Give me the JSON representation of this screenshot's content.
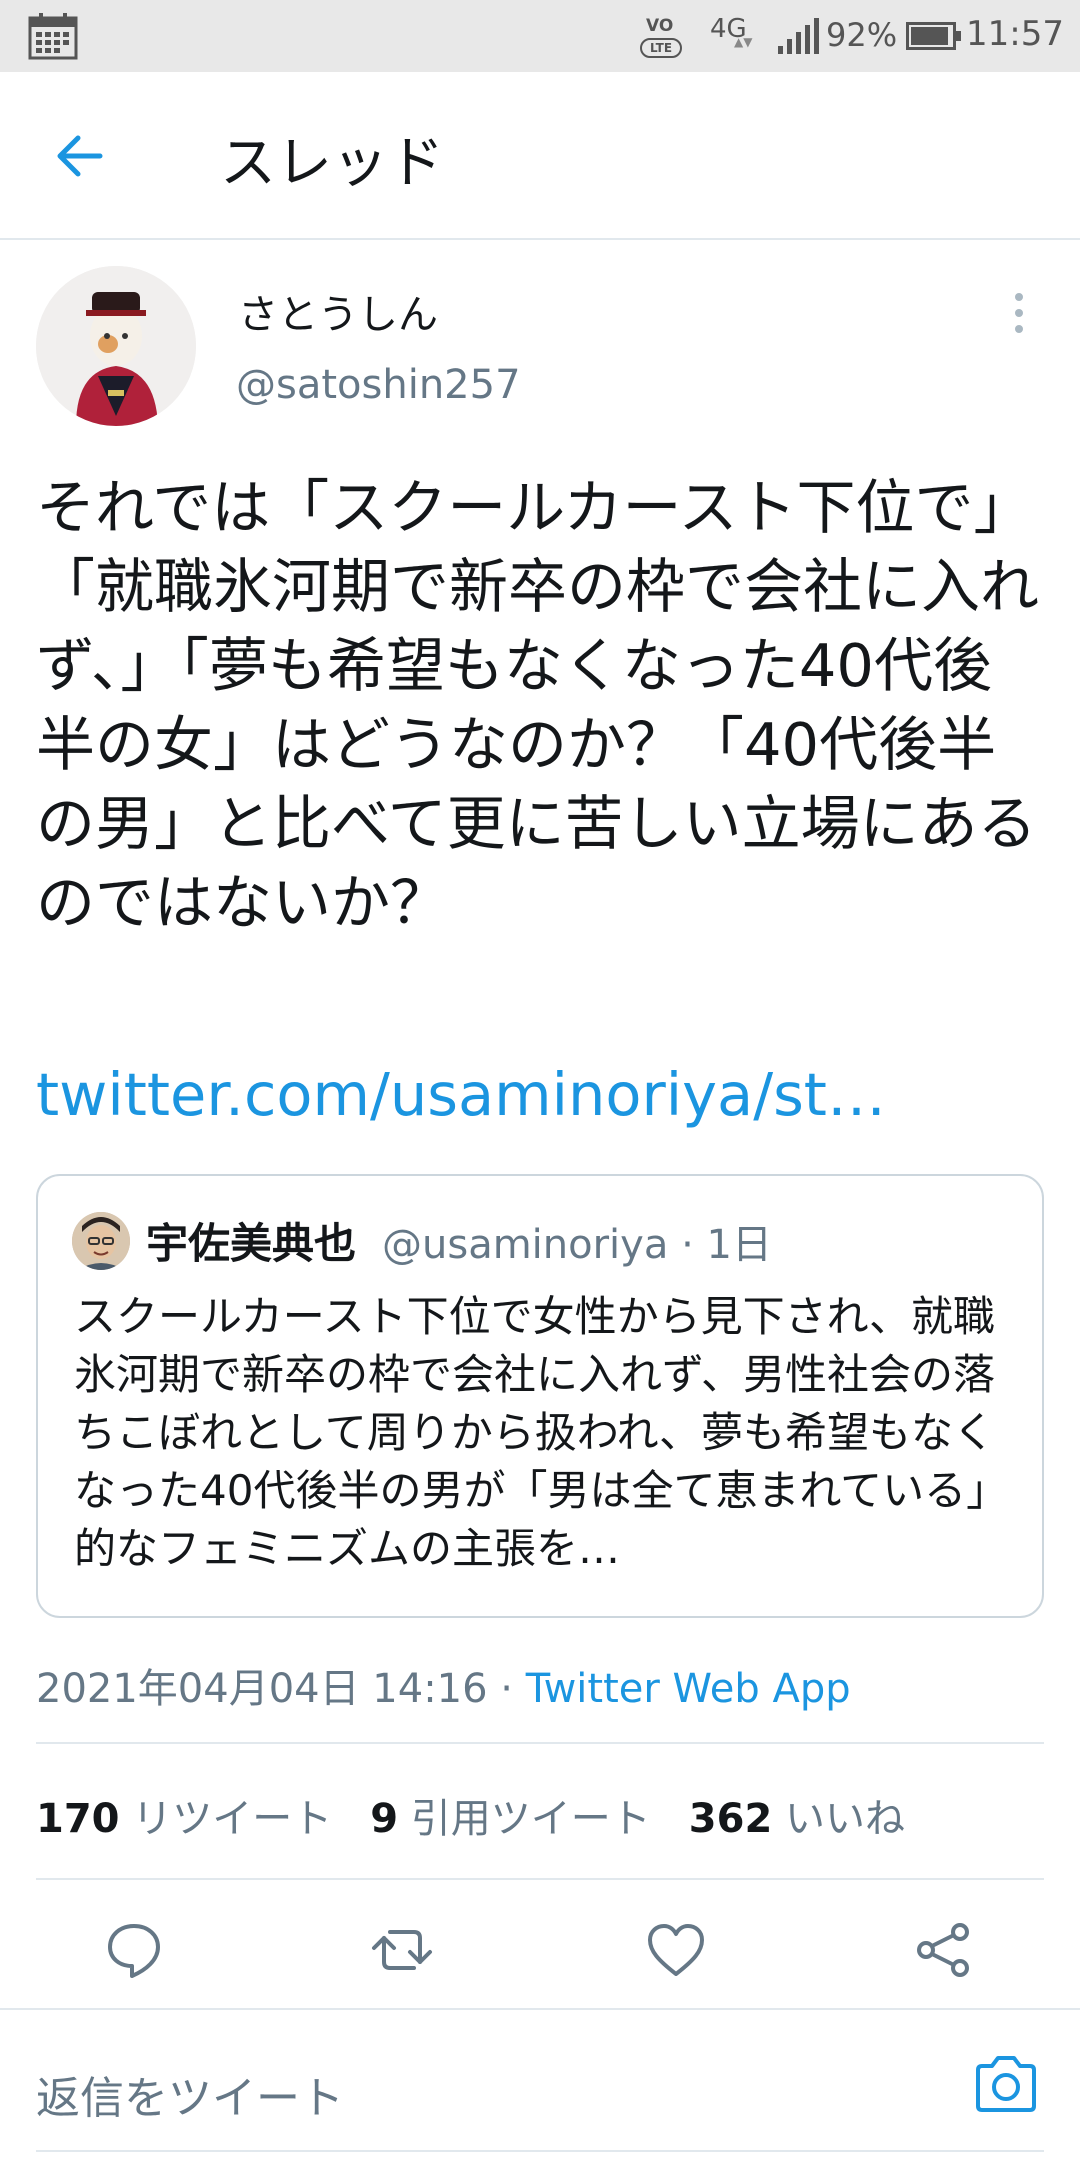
{
  "status_bar": {
    "signal_labels": {
      "vo": "VO",
      "lte": "LTE",
      "network": "4G",
      "net_arrows": "▲▼"
    },
    "battery_percent": "92%",
    "battery_level": 0.92,
    "time": "11:57"
  },
  "header": {
    "title": "スレッド"
  },
  "tweet": {
    "author_name": "さとうしん",
    "author_handle": "@satoshin257",
    "text": "それでは「スクールカースト下位で」「就職氷河期で新卒の枠で会社に入れず、」「夢も希望もなくなった40代後半の女」はどうなのか？「40代後半の男」と比べて更に苦しい立場にあるのではないか？",
    "link": "twitter.com/usaminoriya/st…",
    "quoted": {
      "name": "宇佐美典也",
      "handle_time": "@usaminoriya · 1日",
      "text": "スクールカースト下位で女性から見下され、就職氷河期で新卒の枠で会社に入れず、男性社会の落ちこぼれとして周りから扱われ、夢も希望もなくなった40代後半の男が「男は全て恵まれている」的なフェミニズムの主張を…"
    },
    "datetime": "2021年04月04日 14:16",
    "separator": " · ",
    "app": "Twitter Web App",
    "stats": {
      "retweets_count": "170",
      "retweets_label": "リツイート",
      "quotes_count": "9",
      "quotes_label": "引用ツイート",
      "likes_count": "362",
      "likes_label": "いいね"
    }
  },
  "reply": {
    "placeholder": "返信をツイート"
  },
  "colors": {
    "accent": "#1b95e0",
    "text_primary": "#14171a",
    "text_secondary": "#657786",
    "divider": "#e1e8ed"
  },
  "icons": [
    "calendar-icon",
    "volte-icon",
    "signal-icon",
    "battery-icon",
    "back-arrow-icon",
    "more-vertical-icon",
    "reply-icon",
    "retweet-icon",
    "like-icon",
    "share-icon",
    "camera-icon"
  ]
}
